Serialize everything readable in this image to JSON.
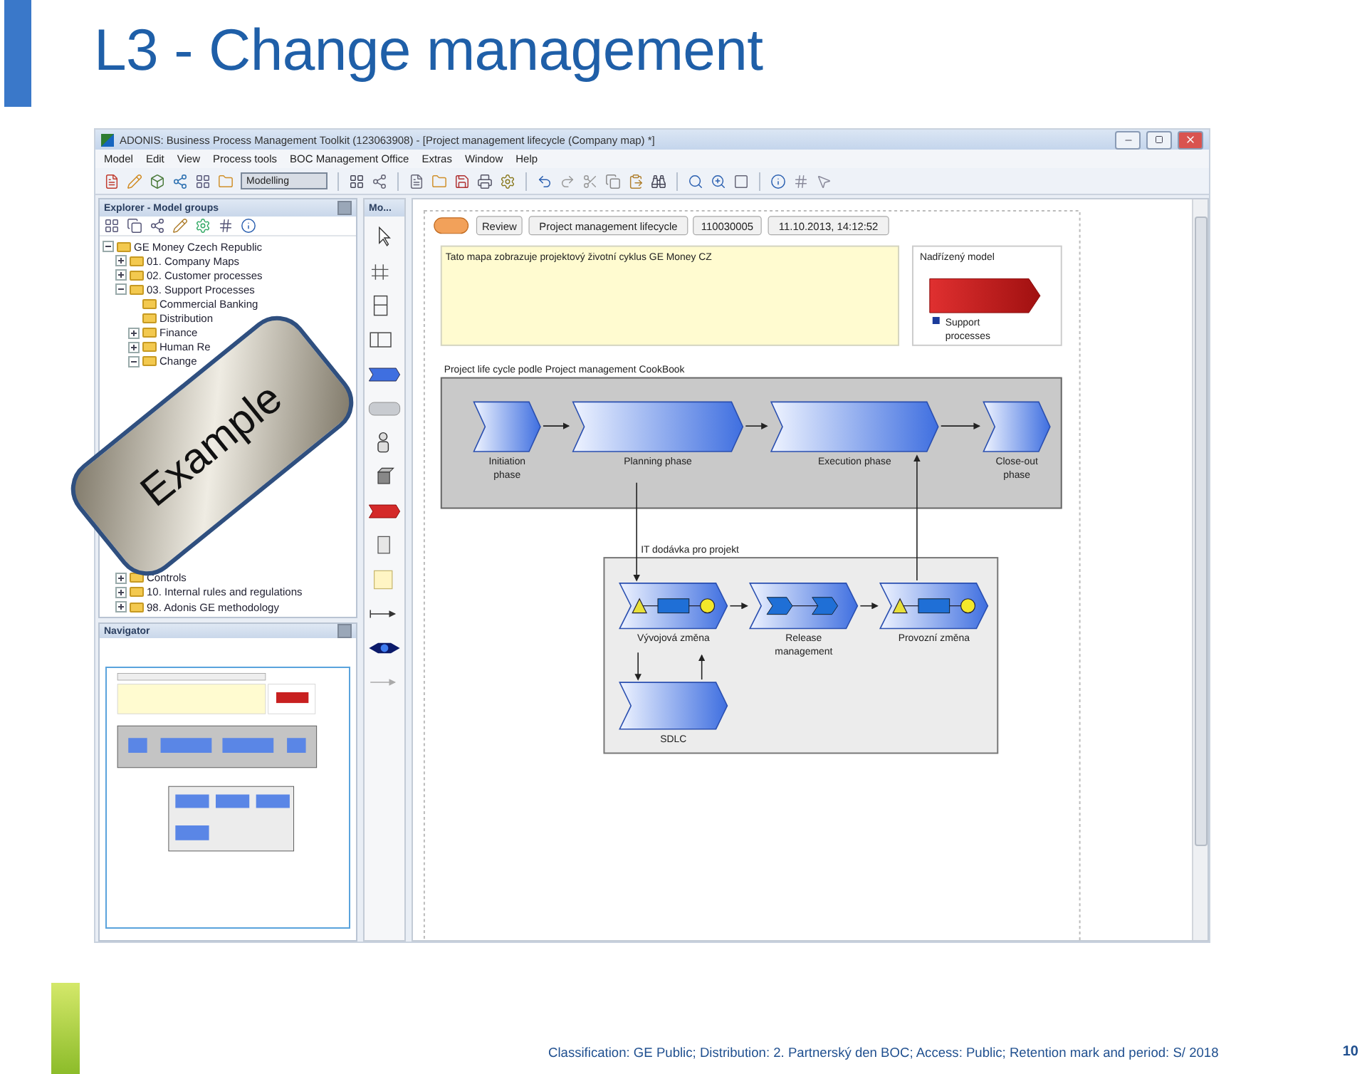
{
  "slide": {
    "title": "L3 - Change management",
    "sticker": "Example",
    "footer": "Classification: GE  Public; Distribution: 2. Partnerský den BOC; Access: Public; Retention mark and period: S/ 2018",
    "page_number": "10"
  },
  "window": {
    "title": "ADONIS: Business Process Management Toolkit (123063908) - [Project management lifecycle (Company map) *]"
  },
  "menu": [
    "Model",
    "Edit",
    "View",
    "Process tools",
    "BOC Management Office",
    "Extras",
    "Window",
    "Help"
  ],
  "toolbar": {
    "mode": "Modelling"
  },
  "explorer": {
    "title": "Explorer - Model groups",
    "tree": [
      {
        "label": "GE Money Czech Republic",
        "expanded": true,
        "children": [
          {
            "label": "01. Company Maps",
            "expanded": false
          },
          {
            "label": "02. Customer processes",
            "expanded": false
          },
          {
            "label": "03. Support Processes",
            "expanded": true,
            "children": [
              {
                "label": "Commercial Banking"
              },
              {
                "label": "Distribution"
              },
              {
                "label": "Finance",
                "expanded": false
              },
              {
                "label": "Human Re",
                "expanded": false
              },
              {
                "label": "Change",
                "expanded": true
              }
            ]
          },
          {
            "label": "Controls",
            "expanded": false
          },
          {
            "label": "10. Internal rules and regulations",
            "expanded": false
          },
          {
            "label": "98. Adonis GE methodology",
            "expanded": false
          }
        ]
      }
    ]
  },
  "navigator": {
    "title": "Navigator"
  },
  "palette": {
    "title": "Mo..."
  },
  "model": {
    "header": [
      "Review",
      "Project management lifecycle",
      "110030005",
      "11.10.2013, 14:12:52"
    ],
    "note": "Tato mapa zobrazuje projektový životní cyklus GE Money CZ",
    "parent": {
      "title": "Nadřízený model",
      "link": "Support processes"
    },
    "groups": [
      {
        "title": "Project life cycle podle Project management CookBook"
      },
      {
        "title": "IT dodávka pro projekt"
      }
    ],
    "processes": [
      {
        "label": "Initiation phase",
        "kind": "phase"
      },
      {
        "label": "Planning phase",
        "kind": "phase"
      },
      {
        "label": "Execution phase",
        "kind": "phase"
      },
      {
        "label": "Close-out phase",
        "kind": "phase"
      },
      {
        "label": "Vývojová změna",
        "kind": "workflow"
      },
      {
        "label": "Release management",
        "kind": "release"
      },
      {
        "label": "Provozní změna",
        "kind": "workflow"
      },
      {
        "label": "SDLC",
        "kind": "phase"
      }
    ]
  }
}
